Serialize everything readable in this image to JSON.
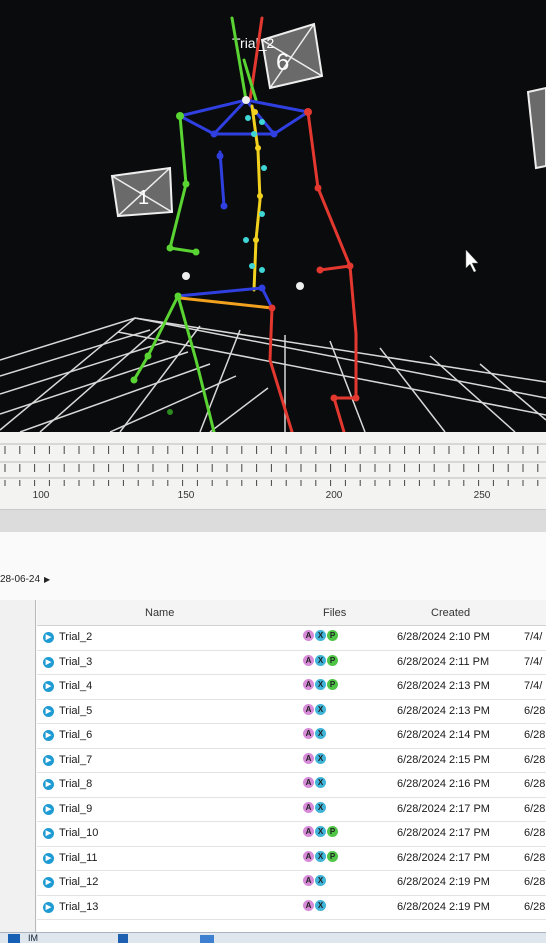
{
  "viewport": {
    "camera_labels": [
      "Trial_2",
      "1",
      "6"
    ],
    "colors": {
      "background": "#0a0b0c",
      "left_limb": "#59d433",
      "right_limb": "#e2382f",
      "spine": "#f2d21f",
      "torso": "#2f3fe0",
      "markers": "#3fd6d6",
      "grid": "#d8d8d8"
    }
  },
  "timeline": {
    "tick_labels": [
      "100",
      "150",
      "200",
      "250"
    ]
  },
  "browser": {
    "breadcrumb": "28-06-24",
    "columns": {
      "name": "Name",
      "files": "Files",
      "created": "Created"
    },
    "rows": [
      {
        "name": "Trial_2",
        "files": [
          "A",
          "X",
          "P"
        ],
        "created": "6/28/2024 2:10 PM",
        "modified": "7/4/"
      },
      {
        "name": "Trial_3",
        "files": [
          "A",
          "X",
          "P"
        ],
        "created": "6/28/2024 2:11 PM",
        "modified": "7/4/"
      },
      {
        "name": "Trial_4",
        "files": [
          "A",
          "X",
          "P"
        ],
        "created": "6/28/2024 2:13 PM",
        "modified": "7/4/"
      },
      {
        "name": "Trial_5",
        "files": [
          "A",
          "X"
        ],
        "created": "6/28/2024 2:13 PM",
        "modified": "6/28"
      },
      {
        "name": "Trial_6",
        "files": [
          "A",
          "X"
        ],
        "created": "6/28/2024 2:14 PM",
        "modified": "6/28"
      },
      {
        "name": "Trial_7",
        "files": [
          "A",
          "X"
        ],
        "created": "6/28/2024 2:15 PM",
        "modified": "6/28"
      },
      {
        "name": "Trial_8",
        "files": [
          "A",
          "X"
        ],
        "created": "6/28/2024 2:16 PM",
        "modified": "6/28"
      },
      {
        "name": "Trial_9",
        "files": [
          "A",
          "X"
        ],
        "created": "6/28/2024 2:17 PM",
        "modified": "6/28"
      },
      {
        "name": "Trial_10",
        "files": [
          "A",
          "X",
          "P"
        ],
        "created": "6/28/2024 2:17 PM",
        "modified": "6/28"
      },
      {
        "name": "Trial_11",
        "files": [
          "A",
          "X",
          "P"
        ],
        "created": "6/28/2024 2:17 PM",
        "modified": "6/28"
      },
      {
        "name": "Trial_12",
        "files": [
          "A",
          "X"
        ],
        "created": "6/28/2024 2:19 PM",
        "modified": "6/28"
      },
      {
        "name": "Trial_13",
        "files": [
          "A",
          "X"
        ],
        "created": "6/28/2024 2:19 PM",
        "modified": "6/28"
      }
    ]
  },
  "taskbar": {
    "item_label": "IM"
  }
}
